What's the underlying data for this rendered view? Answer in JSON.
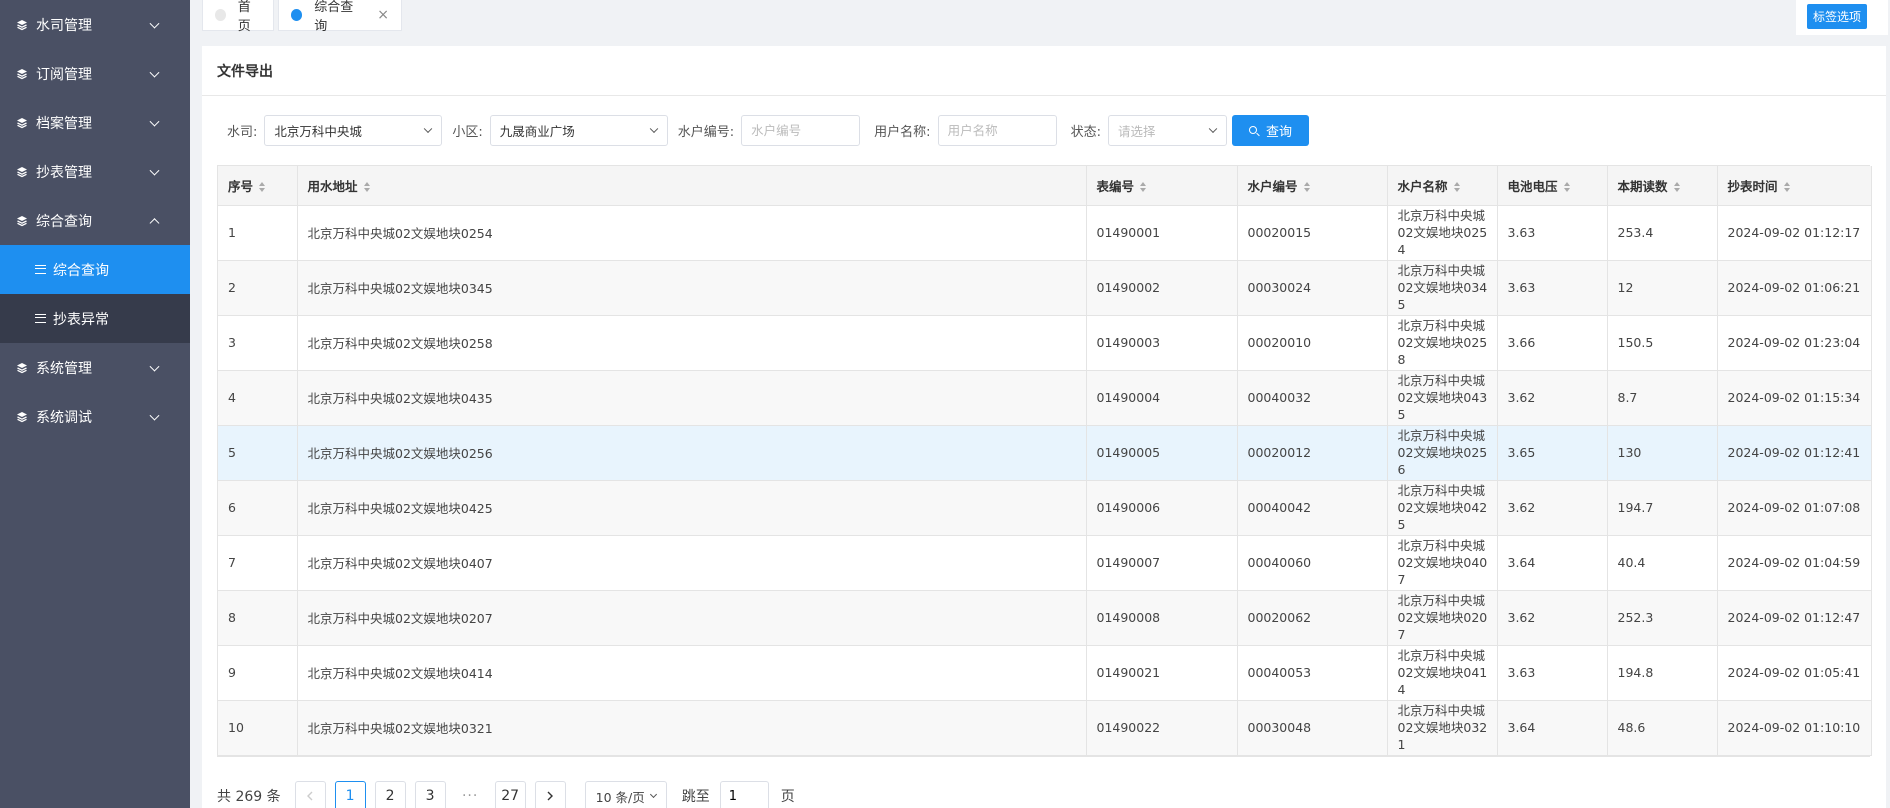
{
  "sidebar": {
    "items": [
      {
        "label": "水司管理"
      },
      {
        "label": "订阅管理"
      },
      {
        "label": "档案管理"
      },
      {
        "label": "抄表管理"
      },
      {
        "label": "综合查询",
        "children": [
          {
            "label": "综合查询",
            "active": true
          },
          {
            "label": "抄表异常"
          }
        ]
      },
      {
        "label": "系统管理"
      },
      {
        "label": "系统调试"
      }
    ]
  },
  "tabs": [
    {
      "label": "首页"
    },
    {
      "label": "综合查询",
      "close": "×"
    }
  ],
  "tag_options_label": "标签选项",
  "card_title": "文件导出",
  "filters": {
    "company_label": "水司:",
    "company_value": "北京万科中央城",
    "community_label": "小区:",
    "community_value": "九晟商业广场",
    "account_label": "水户编号:",
    "account_placeholder": "水户编号",
    "username_label": "用户名称:",
    "username_placeholder": "用户名称",
    "status_label": "状态:",
    "status_placeholder": "请选择",
    "query_label": "查询"
  },
  "table": {
    "columns": [
      "序号",
      "用水地址",
      "表编号",
      "水户编号",
      "水户名称",
      "电池电压",
      "本期读数",
      "抄表时间"
    ],
    "rows": [
      [
        "1",
        "北京万科中央城02文娱地块0254",
        "01490001",
        "00020015",
        "北京万科中央城02文娱地块0254",
        "3.63",
        "253.4",
        "2024-09-02 01:12:17"
      ],
      [
        "2",
        "北京万科中央城02文娱地块0345",
        "01490002",
        "00030024",
        "北京万科中央城02文娱地块0345",
        "3.63",
        "12",
        "2024-09-02 01:06:21"
      ],
      [
        "3",
        "北京万科中央城02文娱地块0258",
        "01490003",
        "00020010",
        "北京万科中央城02文娱地块0258",
        "3.66",
        "150.5",
        "2024-09-02 01:23:04"
      ],
      [
        "4",
        "北京万科中央城02文娱地块0435",
        "01490004",
        "00040032",
        "北京万科中央城02文娱地块0435",
        "3.62",
        "8.7",
        "2024-09-02 01:15:34"
      ],
      [
        "5",
        "北京万科中央城02文娱地块0256",
        "01490005",
        "00020012",
        "北京万科中央城02文娱地块0256",
        "3.65",
        "130",
        "2024-09-02 01:12:41"
      ],
      [
        "6",
        "北京万科中央城02文娱地块0425",
        "01490006",
        "00040042",
        "北京万科中央城02文娱地块0425",
        "3.62",
        "194.7",
        "2024-09-02 01:07:08"
      ],
      [
        "7",
        "北京万科中央城02文娱地块0407",
        "01490007",
        "00040060",
        "北京万科中央城02文娱地块0407",
        "3.64",
        "40.4",
        "2024-09-02 01:04:59"
      ],
      [
        "8",
        "北京万科中央城02文娱地块0207",
        "01490008",
        "00020062",
        "北京万科中央城02文娱地块0207",
        "3.62",
        "252.3",
        "2024-09-02 01:12:47"
      ],
      [
        "9",
        "北京万科中央城02文娱地块0414",
        "01490021",
        "00040053",
        "北京万科中央城02文娱地块0414",
        "3.63",
        "194.8",
        "2024-09-02 01:05:41"
      ],
      [
        "10",
        "北京万科中央城02文娱地块0321",
        "01490022",
        "00030048",
        "北京万科中央城02文娱地块0321",
        "3.64",
        "48.6",
        "2024-09-02 01:10:10"
      ]
    ]
  },
  "pagination": {
    "total": "共 269 条",
    "pages": [
      "1",
      "2",
      "3",
      "27"
    ],
    "current": "1",
    "ellipsis": "···",
    "page_size": "10 条/页",
    "jump_label": "跳至",
    "jump_value": "1",
    "page_suffix": "页"
  },
  "colors": {
    "accent": "#1e8ff0",
    "sidebar_bg": "#4a5064",
    "submenu_bg": "#363b4b"
  }
}
